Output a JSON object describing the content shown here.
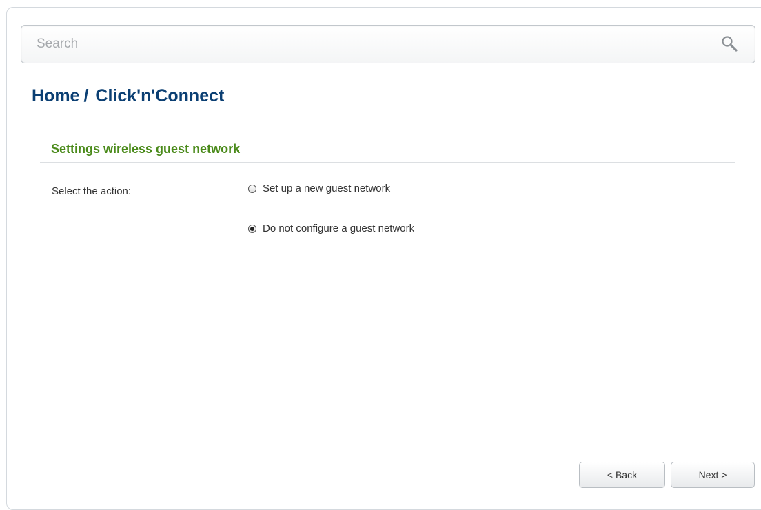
{
  "search": {
    "placeholder": "Search",
    "value": ""
  },
  "breadcrumb": {
    "home": "Home",
    "separator": "/",
    "current": "Click'n'Connect"
  },
  "section": {
    "title": "Settings wireless guest network"
  },
  "action_field": {
    "label": "Select the action:",
    "options": [
      {
        "label": "Set up a new guest network",
        "checked": false
      },
      {
        "label": "Do not configure a guest network",
        "checked": true
      }
    ]
  },
  "footer": {
    "back_label": "< Back",
    "next_label": "Next >"
  },
  "colors": {
    "breadcrumb": "#0b3f73",
    "section_title": "#4a8a1a",
    "border": "#d4d9de"
  },
  "icons": {
    "search": "magnifier-icon"
  }
}
